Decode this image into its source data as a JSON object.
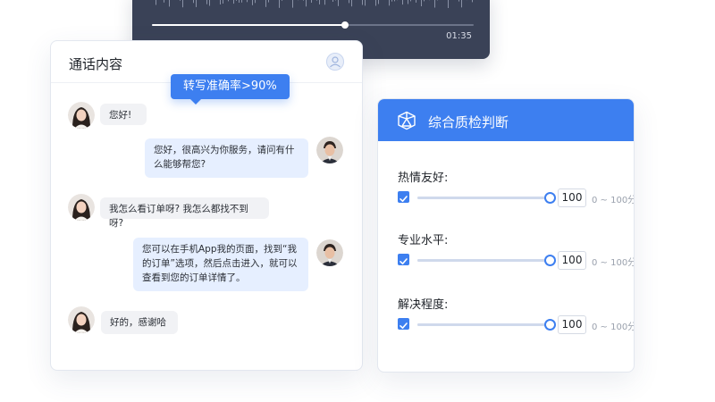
{
  "audio": {
    "time": "01:35",
    "progress": 0.6
  },
  "chat": {
    "title": "通话内容",
    "accuracy_badge": "转写准确率>90%",
    "messages": [
      {
        "role": "customer",
        "text": "您好!"
      },
      {
        "role": "agent",
        "text": "您好，很高兴为你服务，请问有什么能够帮您?"
      },
      {
        "role": "customer",
        "text": "我怎么看订单呀? 我怎么都找不到呀?"
      },
      {
        "role": "agent",
        "text": "您可以在手机App我的页面，找到“我的订单”选项，然后点击进入，就可以查看到您的订单详情了。"
      },
      {
        "role": "customer",
        "text": "好的，感谢哈"
      }
    ]
  },
  "quality": {
    "title": "综合质检判断",
    "icon": "cube-icon",
    "criteria": [
      {
        "label": "热情友好:",
        "score": "100",
        "range": "0 ~ 100分",
        "level": 1.0,
        "checked": true
      },
      {
        "label": "专业水平:",
        "score": "100",
        "range": "0 ~ 100分",
        "level": 1.0,
        "checked": true
      },
      {
        "label": "解决程度:",
        "score": "100",
        "range": "0 ~ 100分",
        "level": 1.0,
        "checked": true
      }
    ]
  },
  "colors": {
    "accent": "#3d7ff0",
    "player_bg": "#3a4257",
    "agent_bubble": "#e6efff",
    "customer_bubble": "#f1f2f5"
  }
}
